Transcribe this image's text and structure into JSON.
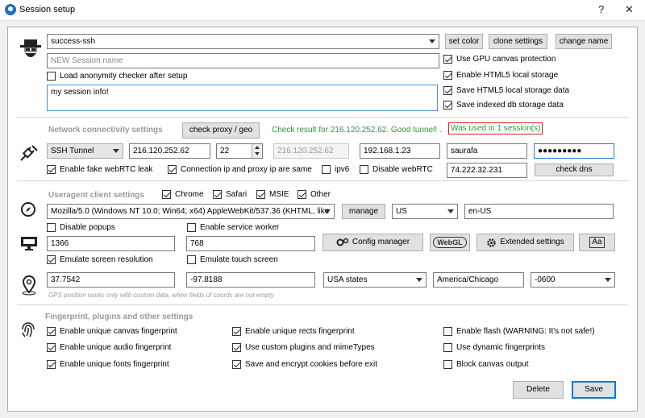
{
  "window": {
    "title": "Session setup",
    "help": "?",
    "close": "✕"
  },
  "profile": {
    "name": "success-ssh",
    "set_color": "set color",
    "clone_settings": "clone settings",
    "change_name": "change name",
    "new_name_placeholder": "NEW Session name",
    "load_checker": "Load anonymity checker after setup",
    "info": "my session info!"
  },
  "storage": {
    "gpu": "Use GPU canvas protection",
    "html5_local": "Enable HTML5 local storage",
    "save_html5": "Save HTML5 local storage data",
    "save_indexed": "Save indexed db storage data"
  },
  "network": {
    "title": "Network connectivity settings",
    "check_btn": "check proxy / geo",
    "result": "Check result for 216.120.252.62. Good tunnel! .",
    "used": "Was used in 1 session(s)",
    "type": "SSH Tunnel",
    "host": "216.120.252.62",
    "port": "22",
    "host_disabled": "216.120.252.62",
    "local_ip": "192.168.1.23",
    "user": "saurafa",
    "password": "●●●●●●●●●",
    "fake_webrtc": "Enable fake webRTC leak",
    "conn_ip_same": "Connection ip and proxy ip are same",
    "ipv6": "ipv6",
    "disable_webrtc": "Disable webRTC",
    "dns_ip": "74.222.32.231",
    "check_dns": "check dns"
  },
  "ua": {
    "title": "Useragent client settings",
    "chrome": "Chrome",
    "safari": "Safari",
    "msie": "MSIE",
    "other": "Other",
    "string": "Mozilla/5.0 (Windows NT 10.0; Win64; x64) AppleWebKit/537.36 (KHTML, like",
    "manage": "manage",
    "country": "US",
    "lang": "en-US",
    "disable_popups": "Disable popups",
    "service_worker": "Enable service worker",
    "config_manager": "Config manager",
    "webgl": "WebGL",
    "extended": "Extended settings",
    "aa": "Aa",
    "width": "1366",
    "height": "768",
    "emulate_res": "Emulate screen resolution",
    "emulate_touch": "Emulate touch screen"
  },
  "gps": {
    "lat": "37.7542",
    "lon": "-97.8188",
    "region": "USA states",
    "tz": "America/Chicago",
    "offset": "-0600",
    "hint": "GPS position works only with custom data, when fields of coords are not empty"
  },
  "fingerprint": {
    "title": "Fingerprint, plugins and other settings",
    "canvas": "Enable unique canvas fingerprint",
    "audio": "Enable unique audio fingerprint",
    "fonts": "Enable unique fonts fingerprint",
    "rects": "Enable unique rects fingerprint",
    "plugins": "Use custom plugins and mimeTypes",
    "cookies": "Save and encrypt cookies before exit",
    "flash": "Enable flash (WARNING: It's not safe!)",
    "dynamic": "Use dynamic fingerprints",
    "block_canvas": "Block canvas output"
  },
  "footer": {
    "delete": "Delete",
    "save": "Save"
  }
}
